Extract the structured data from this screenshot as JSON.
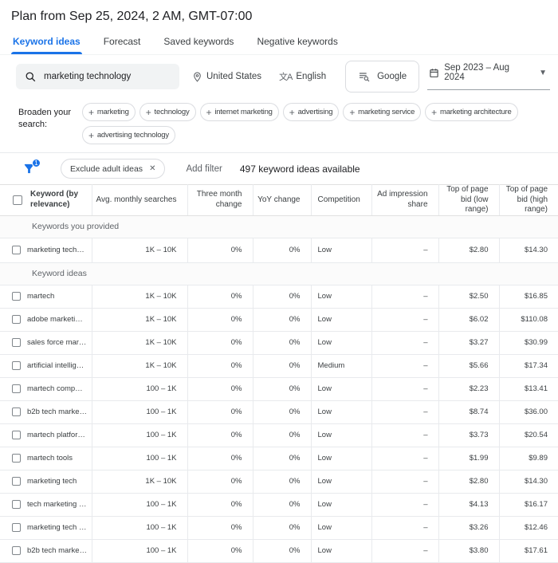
{
  "title": "Plan from Sep 25, 2024, 2 AM, GMT-07:00",
  "tabs": [
    {
      "label": "Keyword ideas",
      "active": true
    },
    {
      "label": "Forecast",
      "active": false
    },
    {
      "label": "Saved keywords",
      "active": false
    },
    {
      "label": "Negative keywords",
      "active": false
    }
  ],
  "toolbar": {
    "search_value": "marketing technology",
    "location": "United States",
    "language": "English",
    "network": "Google",
    "date_range": "Sep 2023 – Aug 2024"
  },
  "broaden": {
    "label": "Broaden your search:",
    "chips": [
      "marketing",
      "technology",
      "internet marketing",
      "advertising",
      "marketing service",
      "marketing architecture",
      "advertising technology"
    ]
  },
  "filter_bar": {
    "badge_count": "1",
    "exclude_chip": "Exclude adult ideas",
    "add_filter": "Add filter",
    "summary": "497 keyword ideas available"
  },
  "table": {
    "columns": [
      "Keyword (by relevance)",
      "Avg. monthly searches",
      "Three month change",
      "YoY change",
      "Competition",
      "Ad impression share",
      "Top of page bid (low range)",
      "Top of page bid (high range)"
    ],
    "sections": [
      {
        "label": "Keywords you provided",
        "rows": [
          [
            "marketing tech…",
            "1K – 10K",
            "0%",
            "0%",
            "Low",
            "–",
            "$2.80",
            "$14.30"
          ]
        ]
      },
      {
        "label": "Keyword ideas",
        "rows": [
          [
            "martech",
            "1K – 10K",
            "0%",
            "0%",
            "Low",
            "–",
            "$2.50",
            "$16.85"
          ],
          [
            "adobe marketi…",
            "1K – 10K",
            "0%",
            "0%",
            "Low",
            "–",
            "$6.02",
            "$110.08"
          ],
          [
            "sales force mar…",
            "1K – 10K",
            "0%",
            "0%",
            "Low",
            "–",
            "$3.27",
            "$30.99"
          ],
          [
            "artificial intellig…",
            "1K – 10K",
            "0%",
            "0%",
            "Medium",
            "–",
            "$5.66",
            "$17.34"
          ],
          [
            "martech comp…",
            "100 – 1K",
            "0%",
            "0%",
            "Low",
            "–",
            "$2.23",
            "$13.41"
          ],
          [
            "b2b tech marke…",
            "100 – 1K",
            "0%",
            "0%",
            "Low",
            "–",
            "$8.74",
            "$36.00"
          ],
          [
            "martech platfor…",
            "100 – 1K",
            "0%",
            "0%",
            "Low",
            "–",
            "$3.73",
            "$20.54"
          ],
          [
            "martech tools",
            "100 – 1K",
            "0%",
            "0%",
            "Low",
            "–",
            "$1.99",
            "$9.89"
          ],
          [
            "marketing tech",
            "1K – 10K",
            "0%",
            "0%",
            "Low",
            "–",
            "$2.80",
            "$14.30"
          ],
          [
            "tech marketing …",
            "100 – 1K",
            "0%",
            "0%",
            "Low",
            "–",
            "$4.13",
            "$16.17"
          ],
          [
            "marketing tech …",
            "100 – 1K",
            "0%",
            "0%",
            "Low",
            "–",
            "$3.26",
            "$12.46"
          ],
          [
            "b2b tech marke…",
            "100 – 1K",
            "0%",
            "0%",
            "Low",
            "–",
            "$3.80",
            "$17.61"
          ]
        ]
      }
    ]
  },
  "colors": {
    "accent": "#1a73e8",
    "text": "#202124",
    "secondary_text": "#5f6368",
    "border": "#e8eaed",
    "chip_border": "#dadce0",
    "searchbox_bg": "#f1f3f4"
  }
}
